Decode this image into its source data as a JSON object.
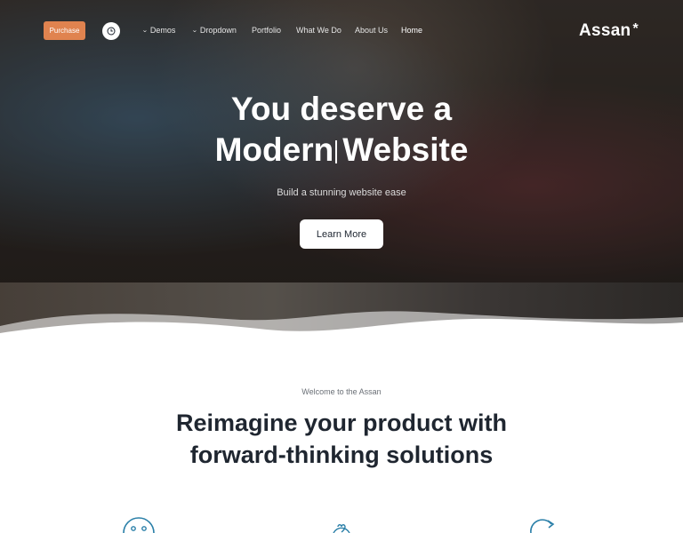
{
  "nav": {
    "purchase_label": "Purchase",
    "items": [
      {
        "label": "Demos",
        "has_dropdown": true
      },
      {
        "label": "Dropdown",
        "has_dropdown": true
      },
      {
        "label": "Portfolio",
        "has_dropdown": false
      },
      {
        "label": "What We Do",
        "has_dropdown": false
      },
      {
        "label": "About Us",
        "has_dropdown": false
      },
      {
        "label": "Home",
        "has_dropdown": false,
        "active": true
      }
    ],
    "logo_text": "Assan",
    "logo_mark": "*"
  },
  "hero": {
    "title_line1": "You deserve a",
    "title_word": "Modern",
    "title_end": "Website",
    "subtitle": "Build a stunning website ease",
    "cta_label": "Learn More"
  },
  "intro": {
    "eyebrow": "Welcome to the Assan",
    "headline_line1": "Reimagine your product with",
    "headline_line2": "forward-thinking solutions"
  },
  "features": {
    "icons": [
      "smile-icon",
      "heart-icon",
      "refresh-icon"
    ]
  },
  "colors": {
    "accent": "#e0834f",
    "heading": "#1f2630",
    "icon_stroke": "#2a7fa8"
  }
}
